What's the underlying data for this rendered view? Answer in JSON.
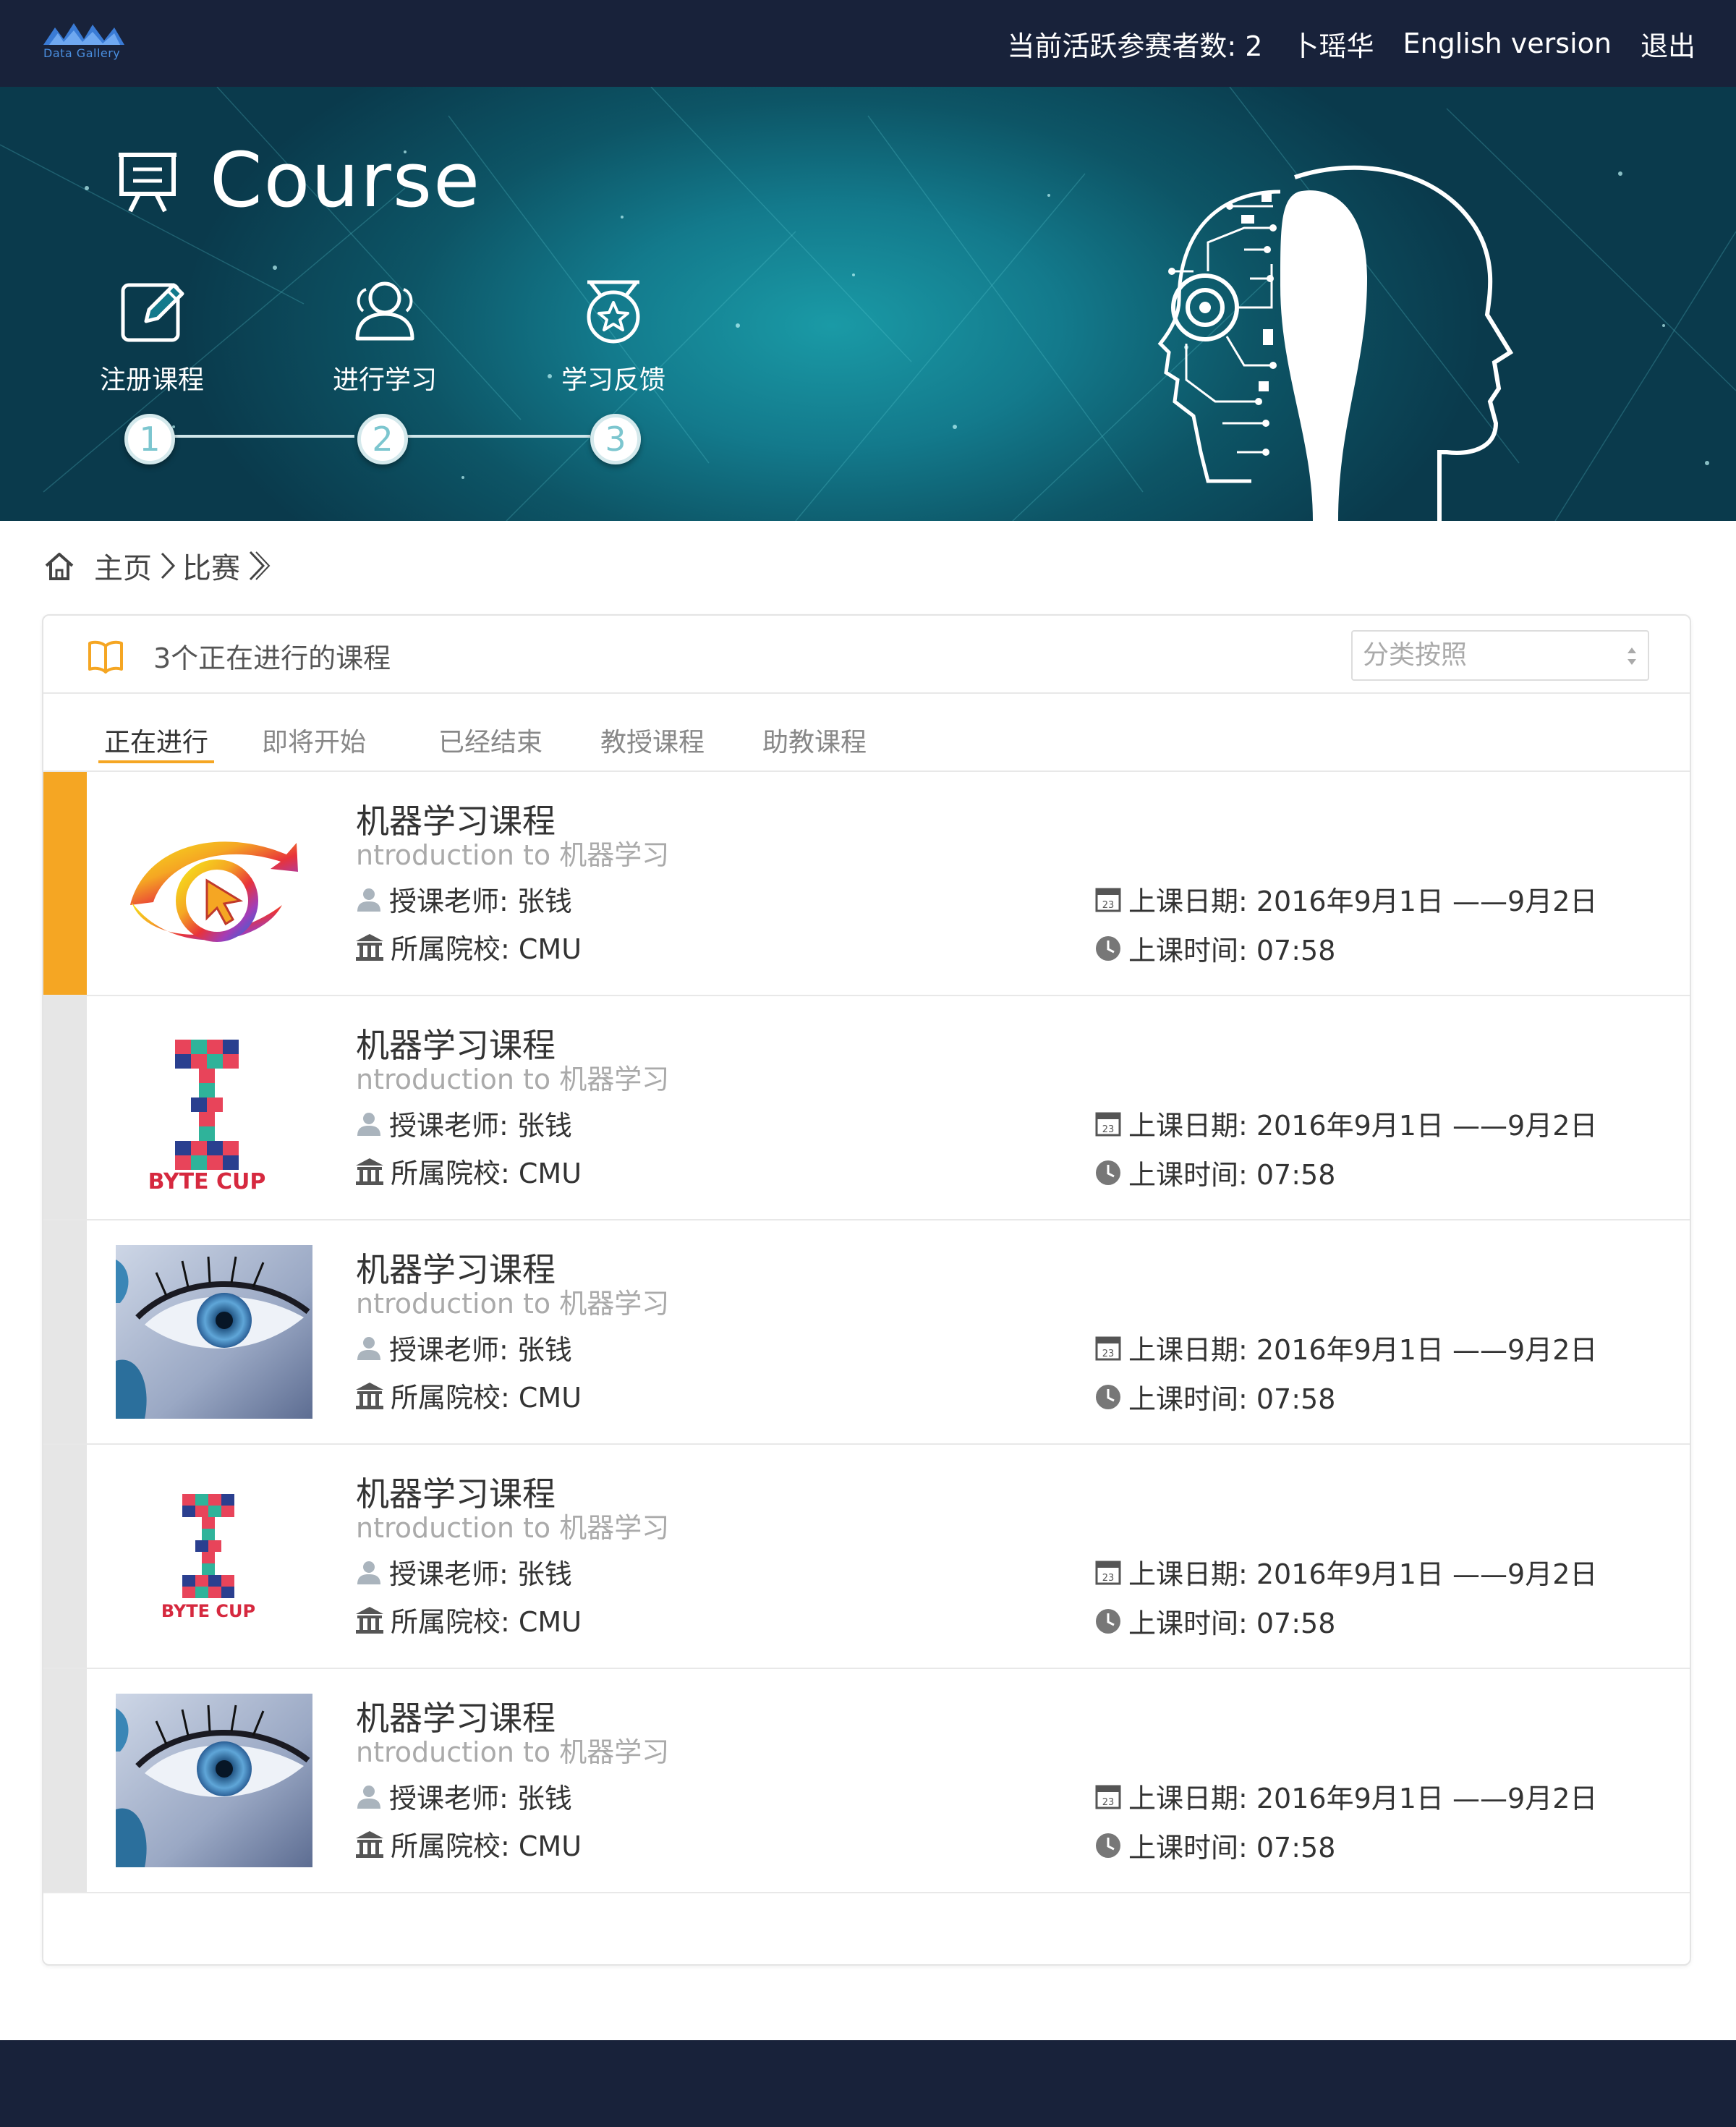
{
  "app": {
    "logo_text": "Data Gallery",
    "colors": {
      "navy": "#18223a",
      "accent": "#f5a623",
      "teal": "#137a8c"
    }
  },
  "topnav": {
    "active_count_label": "当前活跃参赛者数: 2",
    "user_name": "卜瑶华",
    "english_link": "English version",
    "logout": "退出"
  },
  "hero": {
    "title": "Course",
    "steps": [
      {
        "label": "注册课程",
        "number": "1",
        "icon": "edit-icon"
      },
      {
        "label": "进行学习",
        "number": "2",
        "icon": "users-icon"
      },
      {
        "label": "学习反馈",
        "number": "3",
        "icon": "medal-icon"
      }
    ]
  },
  "breadcrumb": {
    "home": "主页",
    "current": "比赛"
  },
  "list": {
    "heading": "3个正在进行的课程",
    "sort_placeholder": "分类按照",
    "tabs": [
      "正在进行",
      "即将开始",
      "已经结束",
      "教授课程",
      "助教课程"
    ],
    "active_tab": "正在进行",
    "courses": [
      {
        "title": "机器学习课程",
        "subtitle": "ntroduction to 机器学习",
        "teacher": "授课老师: 张钱",
        "school": "所属院校: CMU",
        "date": "上课日期: 2016年9月1日 ——9月2日",
        "time": "上课时间:  07:58",
        "thumb": "eye-cursor-logo",
        "active": true
      },
      {
        "title": "机器学习课程",
        "subtitle": "ntroduction to 机器学习",
        "teacher": "授课老师: 张钱",
        "school": "所属院校: CMU",
        "date": "上课日期: 2016年9月1日 ——9月2日",
        "time": "上课时间:  07:58",
        "thumb": "byte-cup-logo",
        "thumb_caption": "BYTE CUP",
        "active": false
      },
      {
        "title": "机器学习课程",
        "subtitle": "ntroduction to 机器学习",
        "teacher": "授课老师: 张钱",
        "school": "所属院校: CMU",
        "date": "上课日期: 2016年9月1日 ——9月2日",
        "time": "上课时间:  07:58",
        "thumb": "blue-eye-photo",
        "active": false
      },
      {
        "title": "机器学习课程",
        "subtitle": "ntroduction to 机器学习",
        "teacher": "授课老师: 张钱",
        "school": "所属院校: CMU",
        "date": "上课日期: 2016年9月1日 ——9月2日",
        "time": "上课时间:  07:58",
        "thumb": "byte-cup-logo",
        "thumb_caption": "BYTE CUP",
        "active": false
      },
      {
        "title": "机器学习课程",
        "subtitle": "ntroduction to 机器学习",
        "teacher": "授课老师: 张钱",
        "school": "所属院校: CMU",
        "date": "上课日期: 2016年9月1日 ——9月2日",
        "time": "上课时间:  07:58",
        "thumb": "blue-eye-photo",
        "active": false
      }
    ]
  }
}
